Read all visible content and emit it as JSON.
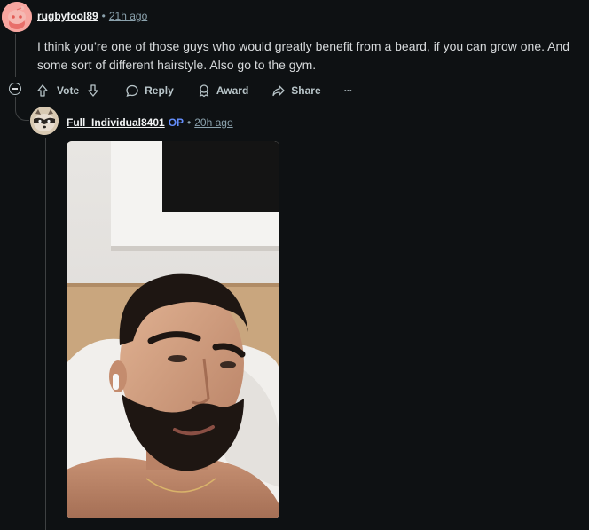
{
  "comment": {
    "username": "rugbyfool89",
    "separator": "•",
    "time_ago": "21h ago",
    "body": "I think you’re one of those guys who would greatly benefit from a beard, if you can grow one. And some sort of different hairstyle. Also go to the gym."
  },
  "actions": {
    "vote_label": "Vote",
    "reply_label": "Reply",
    "award_label": "Award",
    "share_label": "Share",
    "more_label": "···"
  },
  "reply": {
    "username": "Full_Individual8401",
    "op_badge": "OP",
    "separator": "•",
    "time_ago": "20h ago",
    "image_subject": "selfie of a bearded man lying on a white pillow"
  },
  "colors": {
    "background": "#0e1113",
    "text": "#d7dadc",
    "muted": "#8ba2ad",
    "op_blue": "#648efc",
    "thread_line": "#3e4142"
  }
}
